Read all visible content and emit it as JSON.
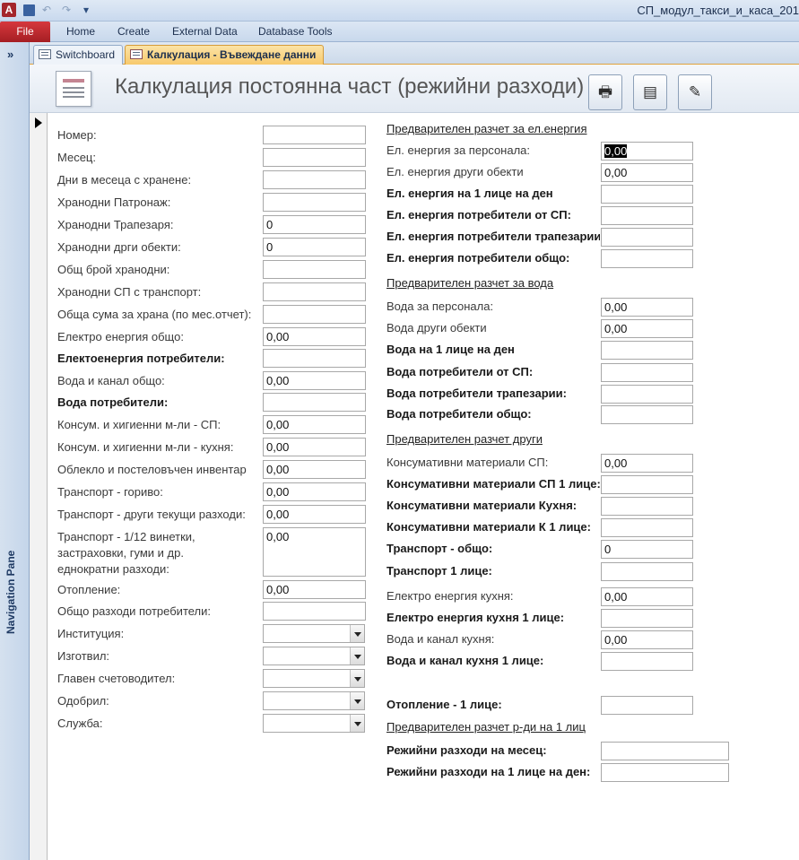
{
  "window": {
    "title": "СП_модул_такси_и_каса_201"
  },
  "quick_access": {
    "save_icon": "save-icon",
    "undo_icon": "undo-icon",
    "redo_icon": "redo-icon",
    "customize_icon": "customize-icon"
  },
  "ribbon": {
    "file": "File",
    "tabs": [
      "Home",
      "Create",
      "External Data",
      "Database Tools"
    ]
  },
  "navigation": {
    "label": "Navigation Pane",
    "toggle": "»"
  },
  "doc_tabs": [
    "Switchboard",
    "Калкулация - Въвеждане данни"
  ],
  "header": {
    "title": "Калкулация постоянна част (режийни разходи)",
    "buttons": [
      "print-icon",
      "form-view-icon",
      "edit-report-icon"
    ]
  },
  "left_fields": [
    {
      "label": "Номер:",
      "value": "",
      "bold": false
    },
    {
      "label": "Месец:",
      "value": "",
      "bold": false
    },
    {
      "label": "Дни в месеца с хранене:",
      "value": "",
      "bold": false
    },
    {
      "label": "Хранодни Патронаж:",
      "value": "",
      "bold": false
    },
    {
      "label": "Хранодни Трапезаря:",
      "value": "0",
      "bold": false
    },
    {
      "label": "Хранодни дрги обекти:",
      "value": "0",
      "bold": false
    },
    {
      "label": "Общ брой хранодни:",
      "value": "",
      "bold": false
    },
    {
      "label": "Хранодни СП с транспорт:",
      "value": "",
      "bold": false
    },
    {
      "label": "Обща сума за храна (по мес.отчет):",
      "value": "",
      "bold": false
    },
    {
      "label": "Електро енергия общо:",
      "value": "0,00",
      "bold": false
    },
    {
      "label": "Електоенергия потребители:",
      "value": "",
      "bold": true
    },
    {
      "label": "Вода и канал общо:",
      "value": "0,00",
      "bold": false
    },
    {
      "label": "Вода потребители:",
      "value": "",
      "bold": true
    },
    {
      "label": "Консум. и хигиенни м-ли - СП:",
      "value": "0,00",
      "bold": false
    },
    {
      "label": "Консум. и хигиенни м-ли - кухня:",
      "value": "0,00",
      "bold": false
    },
    {
      "label": "Облекло и постеловъчен инвентар",
      "value": "0,00",
      "bold": false
    },
    {
      "label": "Транспорт - гориво:",
      "value": "0,00",
      "bold": false
    },
    {
      "label": "Транспорт - други текущи разходи:",
      "value": "0,00",
      "bold": false
    },
    {
      "label": "Транспорт - 1/12 винетки,",
      "label2": "застраховки, гуми и др.",
      "label3": "еднократни разходи:",
      "value": "0,00",
      "bold": false
    },
    {
      "label": "Отопление:",
      "value": "0,00",
      "bold": false
    },
    {
      "label": "Общо разходи потребители:",
      "value": "",
      "bold": false
    },
    {
      "label": "Институция:",
      "value": "",
      "bold": false,
      "combo": true
    },
    {
      "label": "Изготвил:",
      "value": "",
      "bold": false,
      "combo": true
    },
    {
      "label": "Главен счетоводител:",
      "value": "",
      "bold": false,
      "combo": true
    },
    {
      "label": "Одобрил:",
      "value": "",
      "bold": false,
      "combo": true
    },
    {
      "label": "Служба:",
      "value": "",
      "bold": false,
      "combo": true
    }
  ],
  "right_sections": {
    "electricity": {
      "heading": "Предварителен разчет за ел.енергия",
      "rows": [
        {
          "label": "Ел. енергия за персонала:",
          "value": "0,00",
          "bold": false
        },
        {
          "label": "Ел. енергия други обекти",
          "value": "0,00",
          "bold": false
        },
        {
          "label": "Ел. енергия на 1 лице на ден",
          "value": "",
          "bold": true
        },
        {
          "label": "Ел. енергия потребители от СП:",
          "value": "",
          "bold": true
        },
        {
          "label": "Ел. енергия потребители трапезарии",
          "value": "",
          "bold": true
        },
        {
          "label": "Ел. енергия потребители общо:",
          "value": "",
          "bold": true
        }
      ]
    },
    "water": {
      "heading": "Предварителен разчет за вода",
      "rows": [
        {
          "label": "Вода за персонала:",
          "value": "0,00",
          "bold": false
        },
        {
          "label": "Вода други обекти",
          "value": "0,00",
          "bold": false
        },
        {
          "label": "Вода на 1 лице на ден",
          "value": "",
          "bold": true
        },
        {
          "label": "Вода потребители от СП:",
          "value": "",
          "bold": true
        },
        {
          "label": "Вода потребители трапезарии:",
          "value": "",
          "bold": true
        },
        {
          "label": "Вода потребители общо:",
          "value": "",
          "bold": true
        }
      ]
    },
    "other": {
      "heading": "Предварителен разчет други",
      "rows": [
        {
          "label": "Консумативни материали СП:",
          "value": "0,00",
          "bold": false
        },
        {
          "label": "Консумативни материали СП 1 лице:",
          "value": "",
          "bold": true
        },
        {
          "label": "Консумативни материали Кухня:",
          "value": "",
          "bold": true
        },
        {
          "label": "Консумативни материали К 1 лице:",
          "value": "",
          "bold": true
        },
        {
          "label": "Транспорт - общо:",
          "value": "0",
          "bold": true
        },
        {
          "label": "Транспорт 1 лице:",
          "value": "",
          "bold": true
        },
        {
          "label": "Електро енергия кухня:",
          "value": "0,00",
          "bold": false
        },
        {
          "label": "Електро енергия кухня 1 лице:",
          "value": "",
          "bold": true
        },
        {
          "label": "Вода и канал кухня:",
          "value": "0,00",
          "bold": false
        },
        {
          "label": "Вода и канал кухня 1 лице:",
          "value": "",
          "bold": true
        },
        {
          "label": "Отопление -  1 лице:",
          "value": "",
          "bold": true
        }
      ]
    },
    "per_person": {
      "heading": "Предварителен разчет р-ди на 1 лиц",
      "rows": [
        {
          "label": "Режийни разходи на месец:",
          "value": "",
          "bold": true
        },
        {
          "label": "Режийни разходи на 1 лице на ден:",
          "value": "",
          "bold": true
        }
      ]
    }
  }
}
